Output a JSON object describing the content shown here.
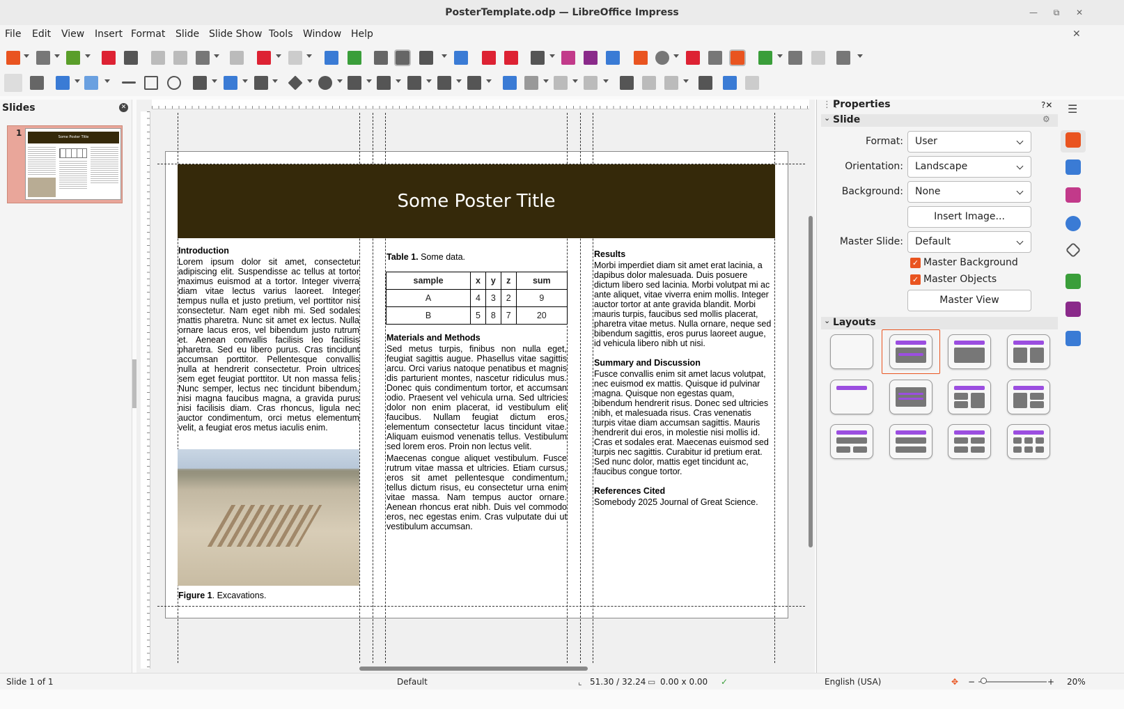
{
  "window": {
    "title": "PosterTemplate.odp — LibreOffice Impress"
  },
  "menu": [
    "File",
    "Edit",
    "View",
    "Insert",
    "Format",
    "Slide",
    "Slide Show",
    "Tools",
    "Window",
    "Help"
  ],
  "slides_pane": {
    "title": "Slides",
    "slide_number": "1",
    "thumb_title": "Some Poster Title"
  },
  "poster": {
    "title": "Some Poster Title",
    "intro_heading": "Introduction",
    "intro_text": "Lorem ipsum dolor sit amet, consectetur adipiscing elit. Suspendisse ac tellus at tortor maximus euismod at a tortor. Integer viverra diam vitae lectus varius laoreet. Integer tempus nulla et justo pretium, vel porttitor nisi consectetur. Nam eget nibh mi. Sed sodales mattis pharetra. Nunc sit amet ex lectus. Nulla ornare lacus eros, vel bibendum justo rutrum et. Aenean convallis facilisis leo facilisis pharetra. Sed eu libero purus. Cras tincidunt accumsan porttitor. Pellentesque convallis nulla at hendrerit consectetur. Proin ultrices sem eget feugiat porttitor. Ut non massa felis. Nunc semper, lectus nec tincidunt bibendum, nisi magna faucibus magna, a gravida purus nisi facilisis diam. Cras rhoncus, ligula nec auctor condimentum, orci metus elementum velit, a feugiat eros metus iaculis enim.",
    "figure_label": "Figure 1",
    "figure_caption": ". Excavations.",
    "table_label": "Table 1.",
    "table_caption": " Some data.",
    "table": {
      "headers": [
        "sample",
        "x",
        "y",
        "z",
        "sum"
      ],
      "rows": [
        [
          "A",
          "4",
          "3",
          "2",
          "9"
        ],
        [
          "B",
          "5",
          "8",
          "7",
          "20"
        ]
      ]
    },
    "methods_heading": "Materials and Methods",
    "methods_text_1": "Sed metus turpis, finibus non nulla eget, feugiat sagittis augue. Phasellus vitae sagittis arcu. Orci varius natoque penatibus et magnis dis parturient montes, nascetur ridiculus mus. Donec quis condimentum tortor, et accumsan odio. Praesent vel vehicula urna. Sed ultricies dolor non enim placerat, id vestibulum elit faucibus. Nullam feugiat dictum eros, elementum consectetur lacus tincidunt vitae. Aliquam euismod venenatis tellus. Vestibulum sed lorem eros. Proin non lectus velit.",
    "methods_text_2": "Maecenas congue aliquet vestibulum. Fusce rutrum vitae massa et ultricies. Etiam cursus, eros sit amet pellentesque condimentum, tellus dictum risus, eu consectetur urna enim vitae massa. Nam tempus auctor ornare. Aenean rhoncus erat nibh. Duis vel commodo eros, nec egestas enim. Cras vulputate dui ut vestibulum accumsan.",
    "results_heading": "Results",
    "results_text": "Morbi imperdiet diam sit amet erat lacinia, a dapibus dolor malesuada. Duis posuere dictum libero sed lacinia. Morbi volutpat mi ac ante aliquet, vitae viverra enim mollis. Integer auctor tortor at ante gravida blandit. Morbi mauris turpis, faucibus sed mollis placerat, pharetra vitae metus. Nulla ornare, neque sed bibendum sagittis, eros purus laoreet augue, id vehicula libero nibh ut nisi.",
    "summary_heading": "Summary and Discussion",
    "summary_text": "Fusce convallis enim sit amet lacus volutpat, nec euismod ex mattis. Quisque id pulvinar magna. Quisque non egestas quam, bibendum hendrerit risus. Donec sed ultricies nibh, et malesuada risus. Cras venenatis turpis vitae diam accumsan sagittis. Mauris hendrerit dui eros, in molestie nisi mollis id. Cras et sodales erat. Maecenas euismod sed turpis nec sagittis. Curabitur id pretium erat. Sed nunc dolor, mattis eget tincidunt ac, faucibus congue tortor.",
    "refs_heading": "References Cited",
    "refs_text": "Somebody 2025 Journal of Great Science."
  },
  "properties": {
    "title": "Properties",
    "section_slide": "Slide",
    "format_label": "Format:",
    "format_value": "User",
    "orientation_label": "Orientation:",
    "orientation_value": "Landscape",
    "background_label": "Background:",
    "background_value": "None",
    "insert_image": "Insert Image...",
    "master_slide_label": "Master Slide:",
    "master_slide_value": "Default",
    "master_background": "Master Background",
    "master_objects": "Master Objects",
    "master_view": "Master View",
    "section_layouts": "Layouts"
  },
  "status": {
    "slide": "Slide 1 of 1",
    "master": "Default",
    "position": "51.30 / 32.24",
    "size": "0.00 x 0.00",
    "language": "English (USA)",
    "zoom": "20%"
  },
  "colors": {
    "banner": "#35290a",
    "accent": "#e95420",
    "layout_bar": "#9b4ee0"
  }
}
